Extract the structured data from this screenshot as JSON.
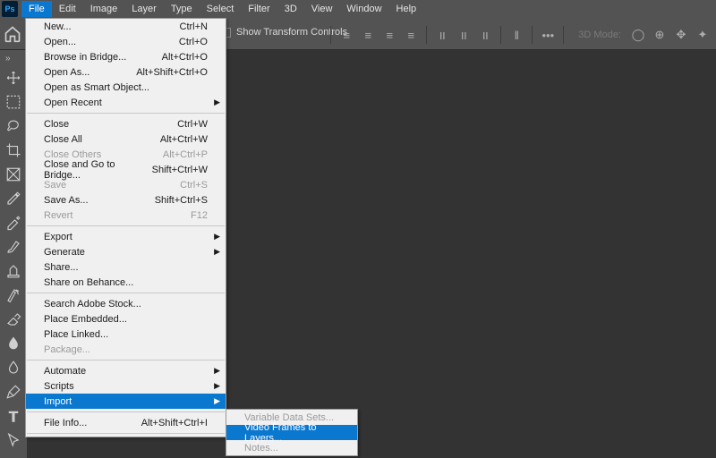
{
  "app": {
    "ps_abbrev": "Ps"
  },
  "menubar": [
    "File",
    "Edit",
    "Image",
    "Layer",
    "Type",
    "Select",
    "Filter",
    "3D",
    "View",
    "Window",
    "Help"
  ],
  "options": {
    "show_transform": "Show Transform Controls",
    "mode_label": "3D Mode:"
  },
  "file_menu": {
    "g1": [
      {
        "l": "New...",
        "s": "Ctrl+N"
      },
      {
        "l": "Open...",
        "s": "Ctrl+O"
      },
      {
        "l": "Browse in Bridge...",
        "s": "Alt+Ctrl+O"
      },
      {
        "l": "Open As...",
        "s": "Alt+Shift+Ctrl+O"
      },
      {
        "l": "Open as Smart Object...",
        "s": ""
      },
      {
        "l": "Open Recent",
        "s": "",
        "sub": true
      }
    ],
    "g2": [
      {
        "l": "Close",
        "s": "Ctrl+W"
      },
      {
        "l": "Close All",
        "s": "Alt+Ctrl+W"
      },
      {
        "l": "Close Others",
        "s": "Alt+Ctrl+P",
        "d": true
      },
      {
        "l": "Close and Go to Bridge...",
        "s": "Shift+Ctrl+W"
      },
      {
        "l": "Save",
        "s": "Ctrl+S",
        "d": true
      },
      {
        "l": "Save As...",
        "s": "Shift+Ctrl+S"
      },
      {
        "l": "Revert",
        "s": "F12",
        "d": true
      }
    ],
    "g3": [
      {
        "l": "Export",
        "s": "",
        "sub": true
      },
      {
        "l": "Generate",
        "s": "",
        "sub": true
      },
      {
        "l": "Share...",
        "s": ""
      },
      {
        "l": "Share on Behance...",
        "s": ""
      }
    ],
    "g4": [
      {
        "l": "Search Adobe Stock...",
        "s": ""
      },
      {
        "l": "Place Embedded...",
        "s": ""
      },
      {
        "l": "Place Linked...",
        "s": ""
      },
      {
        "l": "Package...",
        "s": "",
        "d": true
      }
    ],
    "g5": [
      {
        "l": "Automate",
        "s": "",
        "sub": true
      },
      {
        "l": "Scripts",
        "s": "",
        "sub": true
      },
      {
        "l": "Import",
        "s": "",
        "sub": true,
        "hl": true
      }
    ],
    "g6": [
      {
        "l": "File Info...",
        "s": "Alt+Shift+Ctrl+I"
      }
    ]
  },
  "import_submenu": [
    {
      "l": "Variable Data Sets...",
      "d": true
    },
    {
      "l": "Video Frames to Layers...",
      "hl": true
    },
    {
      "l": "Notes...",
      "d": true
    }
  ]
}
